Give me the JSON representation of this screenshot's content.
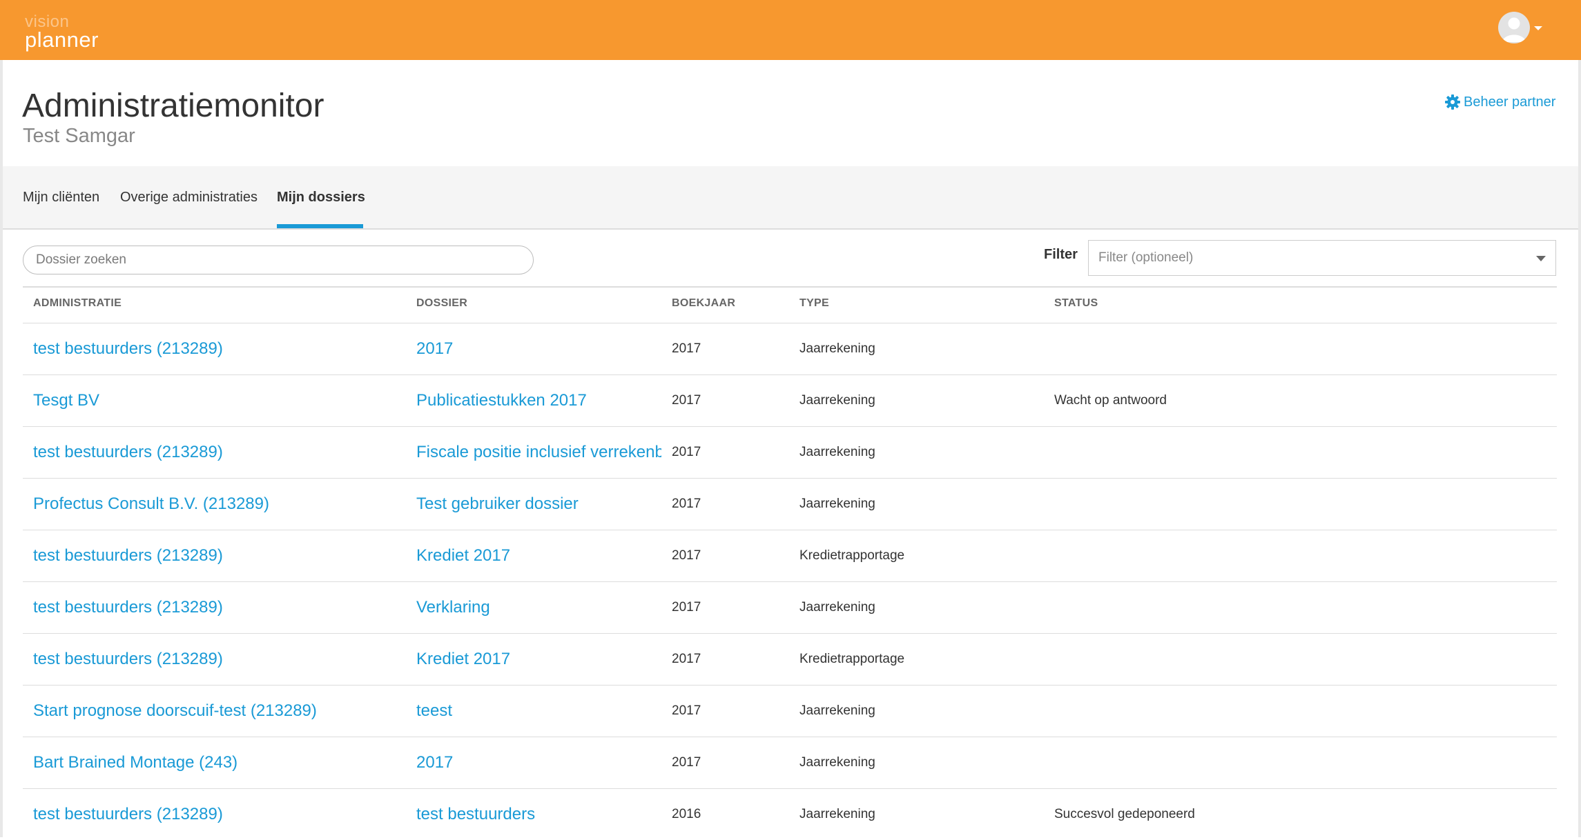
{
  "header": {
    "logo_line1": "vision",
    "logo_line2": "planner",
    "brand_color": "#f7982f"
  },
  "page": {
    "title": "Administratiemonitor",
    "subtitle": "Test Samgar",
    "beheer_label": "Beheer partner",
    "accent_color": "#1a9ad6"
  },
  "tabs": [
    {
      "label": "Mijn cliënten",
      "active": false
    },
    {
      "label": "Overige administraties",
      "active": false
    },
    {
      "label": "Mijn dossiers",
      "active": true
    }
  ],
  "search": {
    "placeholder": "Dossier zoeken"
  },
  "filter": {
    "label": "Filter",
    "placeholder": "Filter (optioneel)"
  },
  "table": {
    "headers": [
      "ADMINISTRATIE",
      "DOSSIER",
      "BOEKJAAR",
      "TYPE",
      "STATUS"
    ],
    "rows": [
      {
        "administratie": "test bestuurders (213289)",
        "dossier": "2017",
        "boekjaar": "2017",
        "type": "Jaarrekening",
        "status": ""
      },
      {
        "administratie": "Tesgt BV",
        "dossier": "Publicatiestukken 2017",
        "boekjaar": "2017",
        "type": "Jaarrekening",
        "status": "Wacht op antwoord"
      },
      {
        "administratie": "test bestuurders (213289)",
        "dossier": "Fiscale positie inclusief verrekenb",
        "boekjaar": "2017",
        "type": "Jaarrekening",
        "status": ""
      },
      {
        "administratie": "Profectus Consult B.V. (213289)",
        "dossier": "Test gebruiker dossier",
        "boekjaar": "2017",
        "type": "Jaarrekening",
        "status": ""
      },
      {
        "administratie": "test bestuurders (213289)",
        "dossier": "Krediet 2017",
        "boekjaar": "2017",
        "type": "Kredietrapportage",
        "status": ""
      },
      {
        "administratie": "test bestuurders (213289)",
        "dossier": "Verklaring",
        "boekjaar": "2017",
        "type": "Jaarrekening",
        "status": ""
      },
      {
        "administratie": "test bestuurders (213289)",
        "dossier": "Krediet 2017",
        "boekjaar": "2017",
        "type": "Kredietrapportage",
        "status": ""
      },
      {
        "administratie": "Start prognose doorscuif-test (213289)",
        "dossier": "teest",
        "boekjaar": "2017",
        "type": "Jaarrekening",
        "status": ""
      },
      {
        "administratie": "Bart Brained Montage (243)",
        "dossier": "2017",
        "boekjaar": "2017",
        "type": "Jaarrekening",
        "status": ""
      },
      {
        "administratie": "test bestuurders (213289)",
        "dossier": "test bestuurders",
        "boekjaar": "2016",
        "type": "Jaarrekening",
        "status": "Succesvol gedeponeerd"
      }
    ]
  }
}
